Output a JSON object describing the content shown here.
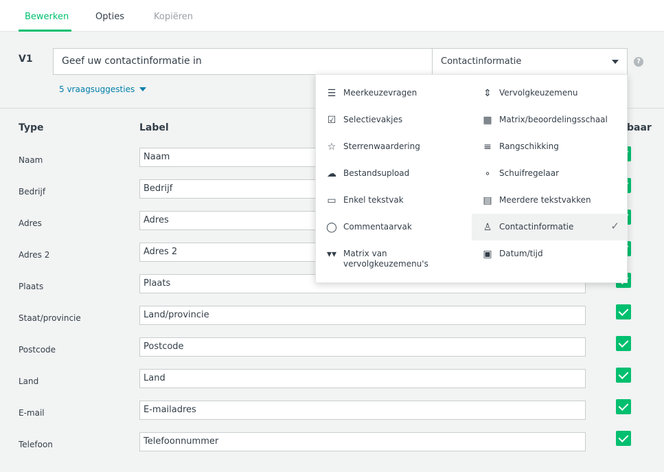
{
  "tabs": [
    {
      "label": "Bewerken"
    },
    {
      "label": "Opties"
    },
    {
      "label": "Kopiëren"
    }
  ],
  "question": {
    "number": "V1",
    "text": "Geef uw contactinformatie in",
    "type": "Contactinformatie",
    "suggestions": "5 vraagsuggesties",
    "help": "?"
  },
  "table": {
    "col_type": "Type",
    "col_label": "Label",
    "col_visible": "baar",
    "rows": [
      {
        "type": "Naam",
        "label": "Naam"
      },
      {
        "type": "Bedrijf",
        "label": "Bedrijf"
      },
      {
        "type": "Adres",
        "label": "Adres"
      },
      {
        "type": "Adres 2",
        "label": "Adres 2"
      },
      {
        "type": "Plaats",
        "label": "Plaats"
      },
      {
        "type": "Staat/provincie",
        "label": "Land/provincie"
      },
      {
        "type": "Postcode",
        "label": "Postcode"
      },
      {
        "type": "Land",
        "label": "Land"
      },
      {
        "type": "E-mail",
        "label": "E-mailadres"
      },
      {
        "type": "Telefoon",
        "label": "Telefoonnummer"
      }
    ]
  },
  "menu": {
    "left": [
      {
        "label": "Meerkeuzevragen",
        "icon": "list-icon"
      },
      {
        "label": "Selectievakjes",
        "icon": "checkbox-icon"
      },
      {
        "label": "Sterrenwaardering",
        "icon": "star-icon"
      },
      {
        "label": "Bestandsupload",
        "icon": "cloud-upload-icon"
      },
      {
        "label": "Enkel tekstvak",
        "icon": "textbox-icon"
      },
      {
        "label": "Commentaarvak",
        "icon": "comment-icon"
      },
      {
        "label": "Matrix van",
        "label2": "vervolgkeuzemenu's",
        "icon": "matrix-dropdown-icon"
      }
    ],
    "right": [
      {
        "label": "Vervolgkeuzemenu",
        "icon": "dropdown-icon"
      },
      {
        "label": "Matrix/beoordelingsschaal",
        "icon": "grid-icon"
      },
      {
        "label": "Rangschikking",
        "icon": "ranking-icon"
      },
      {
        "label": "Schuifregelaar",
        "icon": "slider-icon"
      },
      {
        "label": "Meerdere tekstvakken",
        "icon": "multi-textbox-icon"
      },
      {
        "label": "Contactinformatie",
        "icon": "person-icon"
      },
      {
        "label": "Datum/tijd",
        "icon": "calendar-icon"
      }
    ]
  },
  "colors": {
    "accent": "#00bf6f",
    "link": "#007faa"
  }
}
